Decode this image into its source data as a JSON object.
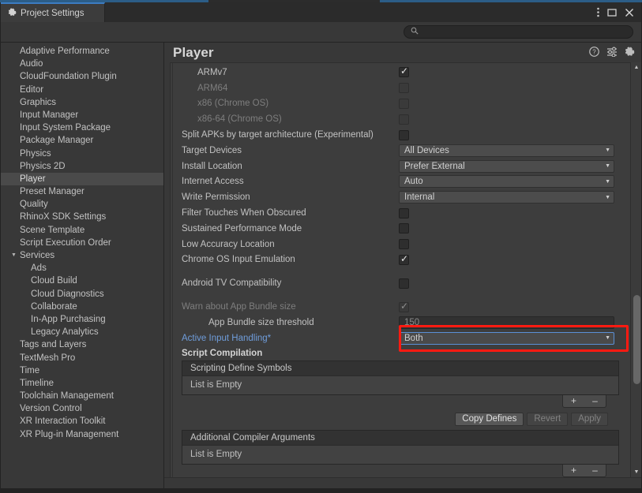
{
  "window": {
    "tab_label": "Project Settings",
    "tab_icon": "gear-icon",
    "controls": {
      "menu": "⋮",
      "maximize": "❐",
      "close": "✕"
    }
  },
  "search": {
    "value": "",
    "placeholder": "",
    "icon": "search-icon"
  },
  "sidebar": {
    "items": [
      {
        "label": "Adaptive Performance",
        "level": 0,
        "selected": false,
        "expandable": false
      },
      {
        "label": "Audio",
        "level": 0,
        "selected": false,
        "expandable": false
      },
      {
        "label": "CloudFoundation Plugin",
        "level": 0,
        "selected": false,
        "expandable": false
      },
      {
        "label": "Editor",
        "level": 0,
        "selected": false,
        "expandable": false
      },
      {
        "label": "Graphics",
        "level": 0,
        "selected": false,
        "expandable": false
      },
      {
        "label": "Input Manager",
        "level": 0,
        "selected": false,
        "expandable": false
      },
      {
        "label": "Input System Package",
        "level": 0,
        "selected": false,
        "expandable": false
      },
      {
        "label": "Package Manager",
        "level": 0,
        "selected": false,
        "expandable": false
      },
      {
        "label": "Physics",
        "level": 0,
        "selected": false,
        "expandable": false
      },
      {
        "label": "Physics 2D",
        "level": 0,
        "selected": false,
        "expandable": false
      },
      {
        "label": "Player",
        "level": 0,
        "selected": true,
        "expandable": false
      },
      {
        "label": "Preset Manager",
        "level": 0,
        "selected": false,
        "expandable": false
      },
      {
        "label": "Quality",
        "level": 0,
        "selected": false,
        "expandable": false
      },
      {
        "label": "RhinoX SDK Settings",
        "level": 0,
        "selected": false,
        "expandable": false
      },
      {
        "label": "Scene Template",
        "level": 0,
        "selected": false,
        "expandable": false
      },
      {
        "label": "Script Execution Order",
        "level": 0,
        "selected": false,
        "expandable": false
      },
      {
        "label": "Services",
        "level": 0,
        "selected": false,
        "expandable": true,
        "arrow": "▼"
      },
      {
        "label": "Ads",
        "level": 1,
        "selected": false,
        "expandable": false
      },
      {
        "label": "Cloud Build",
        "level": 1,
        "selected": false,
        "expandable": false
      },
      {
        "label": "Cloud Diagnostics",
        "level": 1,
        "selected": false,
        "expandable": false
      },
      {
        "label": "Collaborate",
        "level": 1,
        "selected": false,
        "expandable": false
      },
      {
        "label": "In-App Purchasing",
        "level": 1,
        "selected": false,
        "expandable": false
      },
      {
        "label": "Legacy Analytics",
        "level": 1,
        "selected": false,
        "expandable": false
      },
      {
        "label": "Tags and Layers",
        "level": 0,
        "selected": false,
        "expandable": false
      },
      {
        "label": "TextMesh Pro",
        "level": 0,
        "selected": false,
        "expandable": false
      },
      {
        "label": "Time",
        "level": 0,
        "selected": false,
        "expandable": false
      },
      {
        "label": "Timeline",
        "level": 0,
        "selected": false,
        "expandable": false
      },
      {
        "label": "Toolchain Management",
        "level": 0,
        "selected": false,
        "expandable": false
      },
      {
        "label": "Version Control",
        "level": 0,
        "selected": false,
        "expandable": false
      },
      {
        "label": "XR Interaction Toolkit",
        "level": 0,
        "selected": false,
        "expandable": false
      },
      {
        "label": "XR Plug-in Management",
        "level": 0,
        "selected": false,
        "expandable": false
      }
    ]
  },
  "main": {
    "title": "Player",
    "header_icons": [
      {
        "name": "help-icon",
        "glyph": "?"
      },
      {
        "name": "preset-icon",
        "glyph": "preset"
      },
      {
        "name": "gear-icon",
        "glyph": "gear"
      }
    ],
    "rows": [
      {
        "type": "checkbox",
        "label": "ARMv7",
        "indent": 1,
        "checked": true,
        "dim": false
      },
      {
        "type": "checkbox",
        "label": "ARM64",
        "indent": 1,
        "checked": false,
        "dim": true
      },
      {
        "type": "checkbox",
        "label": "x86 (Chrome OS)",
        "indent": 1,
        "checked": false,
        "dim": true
      },
      {
        "type": "checkbox",
        "label": "x86-64 (Chrome OS)",
        "indent": 1,
        "checked": false,
        "dim": true
      },
      {
        "type": "checkbox",
        "label": "Split APKs by target architecture (Experimental)",
        "indent": 0,
        "checked": false,
        "dim": false,
        "clip": true
      },
      {
        "type": "dropdown",
        "label": "Target Devices",
        "indent": 0,
        "value": "All Devices"
      },
      {
        "type": "dropdown",
        "label": "Install Location",
        "indent": 0,
        "value": "Prefer External"
      },
      {
        "type": "dropdown",
        "label": "Internet Access",
        "indent": 0,
        "value": "Auto"
      },
      {
        "type": "dropdown",
        "label": "Write Permission",
        "indent": 0,
        "value": "Internal"
      },
      {
        "type": "checkbox",
        "label": "Filter Touches When Obscured",
        "indent": 0,
        "checked": false,
        "dim": false
      },
      {
        "type": "checkbox",
        "label": "Sustained Performance Mode",
        "indent": 0,
        "checked": false,
        "dim": false
      },
      {
        "type": "checkbox",
        "label": "Low Accuracy Location",
        "indent": 0,
        "checked": false,
        "dim": false
      },
      {
        "type": "checkbox",
        "label": "Chrome OS Input Emulation",
        "indent": 0,
        "checked": true,
        "dim": false
      },
      {
        "type": "spacer"
      },
      {
        "type": "checkbox",
        "label": "Android TV Compatibility",
        "indent": 0,
        "checked": false,
        "dim": false
      },
      {
        "type": "spacer"
      },
      {
        "type": "checkbox",
        "label": "Warn about App Bundle size",
        "indent": 0,
        "checked": true,
        "dim": true
      },
      {
        "type": "text",
        "label": "App Bundle size threshold",
        "indent": 2,
        "value": "150"
      },
      {
        "type": "dropdown-focused",
        "label": "Active Input Handling*",
        "indent": 0,
        "value": "Both",
        "link": true,
        "highlighted": true
      }
    ],
    "script_compilation": {
      "title": "Script Compilation",
      "lists": [
        {
          "header": "Scripting Define Symbols",
          "empty_text": "List is Empty",
          "add": "+",
          "remove": "–"
        },
        {
          "header": "Additional Compiler Arguments",
          "empty_text": "List is Empty",
          "add": "+",
          "remove": "–"
        }
      ],
      "buttons": [
        {
          "label": "Copy Defines",
          "disabled": false
        },
        {
          "label": "Revert",
          "disabled": true
        },
        {
          "label": "Apply",
          "disabled": true
        }
      ]
    },
    "scrollbar": {
      "up": "▲",
      "down": "▼"
    }
  },
  "colors": {
    "accent_blue": "#3c7cc2",
    "highlight_red": "#ff1a11",
    "panel_bg": "#383838",
    "content_bg": "#3d3d3d",
    "link_blue": "#6f9ddb",
    "warning_yellow": "#e3a21a"
  }
}
